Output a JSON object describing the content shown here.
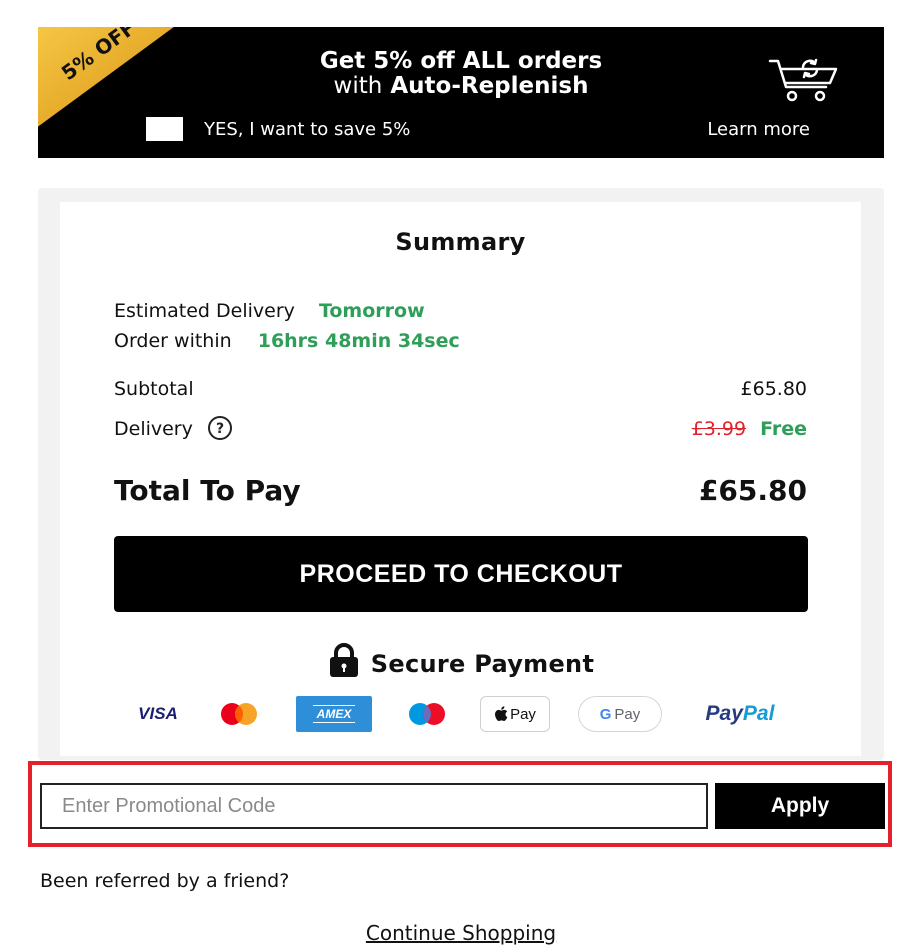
{
  "banner": {
    "badge_text": "5% OFF",
    "title_line1": "Get 5% off ALL orders",
    "title_line2_prefix": "with",
    "title_line2_bold": "Auto-Replenish",
    "checkbox_label": "YES, I want to save 5%",
    "learn_more": "Learn more",
    "checked": false
  },
  "summary": {
    "title": "Summary",
    "delivery_label": "Estimated Delivery",
    "delivery_value": "Tomorrow",
    "order_within_label": "Order within",
    "order_within_value": "16hrs 48min 34sec",
    "subtotal_label": "Subtotal",
    "subtotal_value": "£65.80",
    "delivery_cost_label": "Delivery",
    "delivery_old_price": "£3.99",
    "delivery_new_price": "Free",
    "total_label": "Total To Pay",
    "total_value": "£65.80",
    "checkout_label": "PROCEED TO CHECKOUT",
    "secure_label": "Secure Payment"
  },
  "payment_methods": [
    {
      "name": "visa",
      "label": "VISA"
    },
    {
      "name": "mastercard",
      "label": ""
    },
    {
      "name": "amex",
      "label": "AMEX"
    },
    {
      "name": "maestro",
      "label": ""
    },
    {
      "name": "apple-pay",
      "label": "Pay"
    },
    {
      "name": "google-pay",
      "label": "Pay"
    },
    {
      "name": "paypal",
      "label": "PayPal"
    }
  ],
  "promo": {
    "placeholder": "Enter Promotional Code",
    "value": "",
    "apply_label": "Apply"
  },
  "footer": {
    "referred": "Been referred by a friend?",
    "continue": "Continue Shopping"
  },
  "colors": {
    "green": "#2e9e58",
    "red": "#e3202c",
    "badge": "#f2b21b"
  }
}
